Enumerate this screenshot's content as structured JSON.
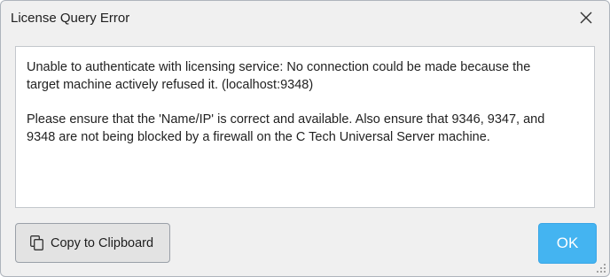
{
  "window": {
    "title": "License Query Error"
  },
  "message": {
    "paragraph1": "Unable to authenticate with licensing service: No connection could be made because the\ntarget machine actively refused it. (localhost:9348)",
    "paragraph2": "Please ensure that the 'Name/IP' is correct and available. Also ensure that 9346, 9347, and\n9348 are not being blocked by a firewall on the C Tech Universal Server machine."
  },
  "buttons": {
    "copy_label": "Copy to Clipboard",
    "copy_icon": "copy-icon",
    "ok_label": "OK"
  },
  "icons": {
    "close": "close-icon",
    "resize": "resize-grip-icon"
  },
  "colors": {
    "accent": "#44b4f1",
    "dialog_bg": "#f0f0f0",
    "message_bg": "#ffffff"
  }
}
